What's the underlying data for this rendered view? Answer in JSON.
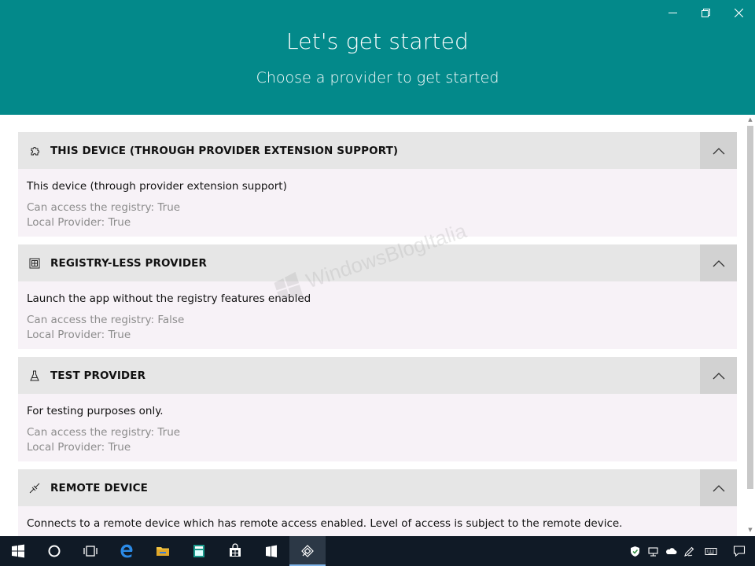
{
  "header": {
    "title": "Let's get started",
    "subtitle": "Choose a provider to get started",
    "bg_color": "#03898a"
  },
  "window_controls": [
    "minimize-icon",
    "restore-icon",
    "close-icon"
  ],
  "providers": [
    {
      "icon": "puzzle-icon",
      "title": "THIS DEVICE (THROUGH PROVIDER EXTENSION SUPPORT)",
      "description": "This device (through provider extension support)",
      "registry": "Can access the registry: True",
      "local": "Local Provider: True"
    },
    {
      "icon": "grid-icon",
      "title": "REGISTRY-LESS PROVIDER",
      "description": "Launch the app without the registry features enabled",
      "registry": "Can access the registry: False",
      "local": "Local Provider: True"
    },
    {
      "icon": "beaker-icon",
      "title": "TEST PROVIDER",
      "description": "For testing purposes only.",
      "registry": "Can access the registry: True",
      "local": "Local Provider: True"
    },
    {
      "icon": "remote-connect-icon",
      "title": "REMOTE DEVICE",
      "description": "Connects to a remote device which has remote access enabled. Level of access is subject to the remote device."
    }
  ],
  "watermark": "WindowsBlogItalia",
  "taskbar": {
    "apps": [
      "windows-start-icon",
      "cortana-icon",
      "task-view-icon",
      "edge-icon",
      "file-explorer-icon",
      "calculator-icon",
      "store-icon",
      "app-icon",
      "registry-app-icon"
    ],
    "tray": [
      "defender-icon",
      "network-icon",
      "onedrive-icon",
      "pen-icon",
      "keyboard-icon",
      "notifications-icon"
    ]
  }
}
